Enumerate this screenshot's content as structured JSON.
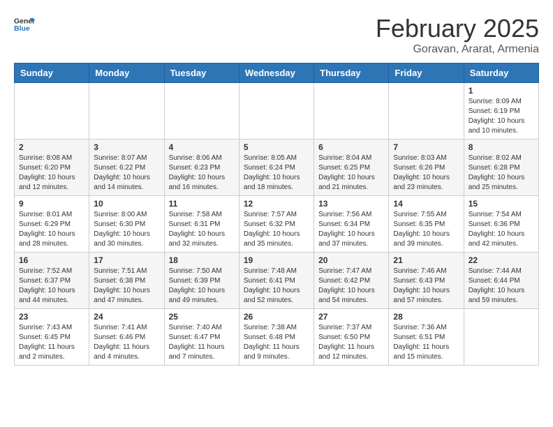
{
  "header": {
    "logo_line1": "General",
    "logo_line2": "Blue",
    "month": "February 2025",
    "location": "Goravan, Ararat, Armenia"
  },
  "weekdays": [
    "Sunday",
    "Monday",
    "Tuesday",
    "Wednesday",
    "Thursday",
    "Friday",
    "Saturday"
  ],
  "weeks": [
    [
      {
        "day": "",
        "info": ""
      },
      {
        "day": "",
        "info": ""
      },
      {
        "day": "",
        "info": ""
      },
      {
        "day": "",
        "info": ""
      },
      {
        "day": "",
        "info": ""
      },
      {
        "day": "",
        "info": ""
      },
      {
        "day": "1",
        "info": "Sunrise: 8:09 AM\nSunset: 6:19 PM\nDaylight: 10 hours\nand 10 minutes."
      }
    ],
    [
      {
        "day": "2",
        "info": "Sunrise: 8:08 AM\nSunset: 6:20 PM\nDaylight: 10 hours\nand 12 minutes."
      },
      {
        "day": "3",
        "info": "Sunrise: 8:07 AM\nSunset: 6:22 PM\nDaylight: 10 hours\nand 14 minutes."
      },
      {
        "day": "4",
        "info": "Sunrise: 8:06 AM\nSunset: 6:23 PM\nDaylight: 10 hours\nand 16 minutes."
      },
      {
        "day": "5",
        "info": "Sunrise: 8:05 AM\nSunset: 6:24 PM\nDaylight: 10 hours\nand 18 minutes."
      },
      {
        "day": "6",
        "info": "Sunrise: 8:04 AM\nSunset: 6:25 PM\nDaylight: 10 hours\nand 21 minutes."
      },
      {
        "day": "7",
        "info": "Sunrise: 8:03 AM\nSunset: 6:26 PM\nDaylight: 10 hours\nand 23 minutes."
      },
      {
        "day": "8",
        "info": "Sunrise: 8:02 AM\nSunset: 6:28 PM\nDaylight: 10 hours\nand 25 minutes."
      }
    ],
    [
      {
        "day": "9",
        "info": "Sunrise: 8:01 AM\nSunset: 6:29 PM\nDaylight: 10 hours\nand 28 minutes."
      },
      {
        "day": "10",
        "info": "Sunrise: 8:00 AM\nSunset: 6:30 PM\nDaylight: 10 hours\nand 30 minutes."
      },
      {
        "day": "11",
        "info": "Sunrise: 7:58 AM\nSunset: 6:31 PM\nDaylight: 10 hours\nand 32 minutes."
      },
      {
        "day": "12",
        "info": "Sunrise: 7:57 AM\nSunset: 6:32 PM\nDaylight: 10 hours\nand 35 minutes."
      },
      {
        "day": "13",
        "info": "Sunrise: 7:56 AM\nSunset: 6:34 PM\nDaylight: 10 hours\nand 37 minutes."
      },
      {
        "day": "14",
        "info": "Sunrise: 7:55 AM\nSunset: 6:35 PM\nDaylight: 10 hours\nand 39 minutes."
      },
      {
        "day": "15",
        "info": "Sunrise: 7:54 AM\nSunset: 6:36 PM\nDaylight: 10 hours\nand 42 minutes."
      }
    ],
    [
      {
        "day": "16",
        "info": "Sunrise: 7:52 AM\nSunset: 6:37 PM\nDaylight: 10 hours\nand 44 minutes."
      },
      {
        "day": "17",
        "info": "Sunrise: 7:51 AM\nSunset: 6:38 PM\nDaylight: 10 hours\nand 47 minutes."
      },
      {
        "day": "18",
        "info": "Sunrise: 7:50 AM\nSunset: 6:39 PM\nDaylight: 10 hours\nand 49 minutes."
      },
      {
        "day": "19",
        "info": "Sunrise: 7:48 AM\nSunset: 6:41 PM\nDaylight: 10 hours\nand 52 minutes."
      },
      {
        "day": "20",
        "info": "Sunrise: 7:47 AM\nSunset: 6:42 PM\nDaylight: 10 hours\nand 54 minutes."
      },
      {
        "day": "21",
        "info": "Sunrise: 7:46 AM\nSunset: 6:43 PM\nDaylight: 10 hours\nand 57 minutes."
      },
      {
        "day": "22",
        "info": "Sunrise: 7:44 AM\nSunset: 6:44 PM\nDaylight: 10 hours\nand 59 minutes."
      }
    ],
    [
      {
        "day": "23",
        "info": "Sunrise: 7:43 AM\nSunset: 6:45 PM\nDaylight: 11 hours\nand 2 minutes."
      },
      {
        "day": "24",
        "info": "Sunrise: 7:41 AM\nSunset: 6:46 PM\nDaylight: 11 hours\nand 4 minutes."
      },
      {
        "day": "25",
        "info": "Sunrise: 7:40 AM\nSunset: 6:47 PM\nDaylight: 11 hours\nand 7 minutes."
      },
      {
        "day": "26",
        "info": "Sunrise: 7:38 AM\nSunset: 6:48 PM\nDaylight: 11 hours\nand 9 minutes."
      },
      {
        "day": "27",
        "info": "Sunrise: 7:37 AM\nSunset: 6:50 PM\nDaylight: 11 hours\nand 12 minutes."
      },
      {
        "day": "28",
        "info": "Sunrise: 7:36 AM\nSunset: 6:51 PM\nDaylight: 11 hours\nand 15 minutes."
      },
      {
        "day": "",
        "info": ""
      }
    ]
  ]
}
